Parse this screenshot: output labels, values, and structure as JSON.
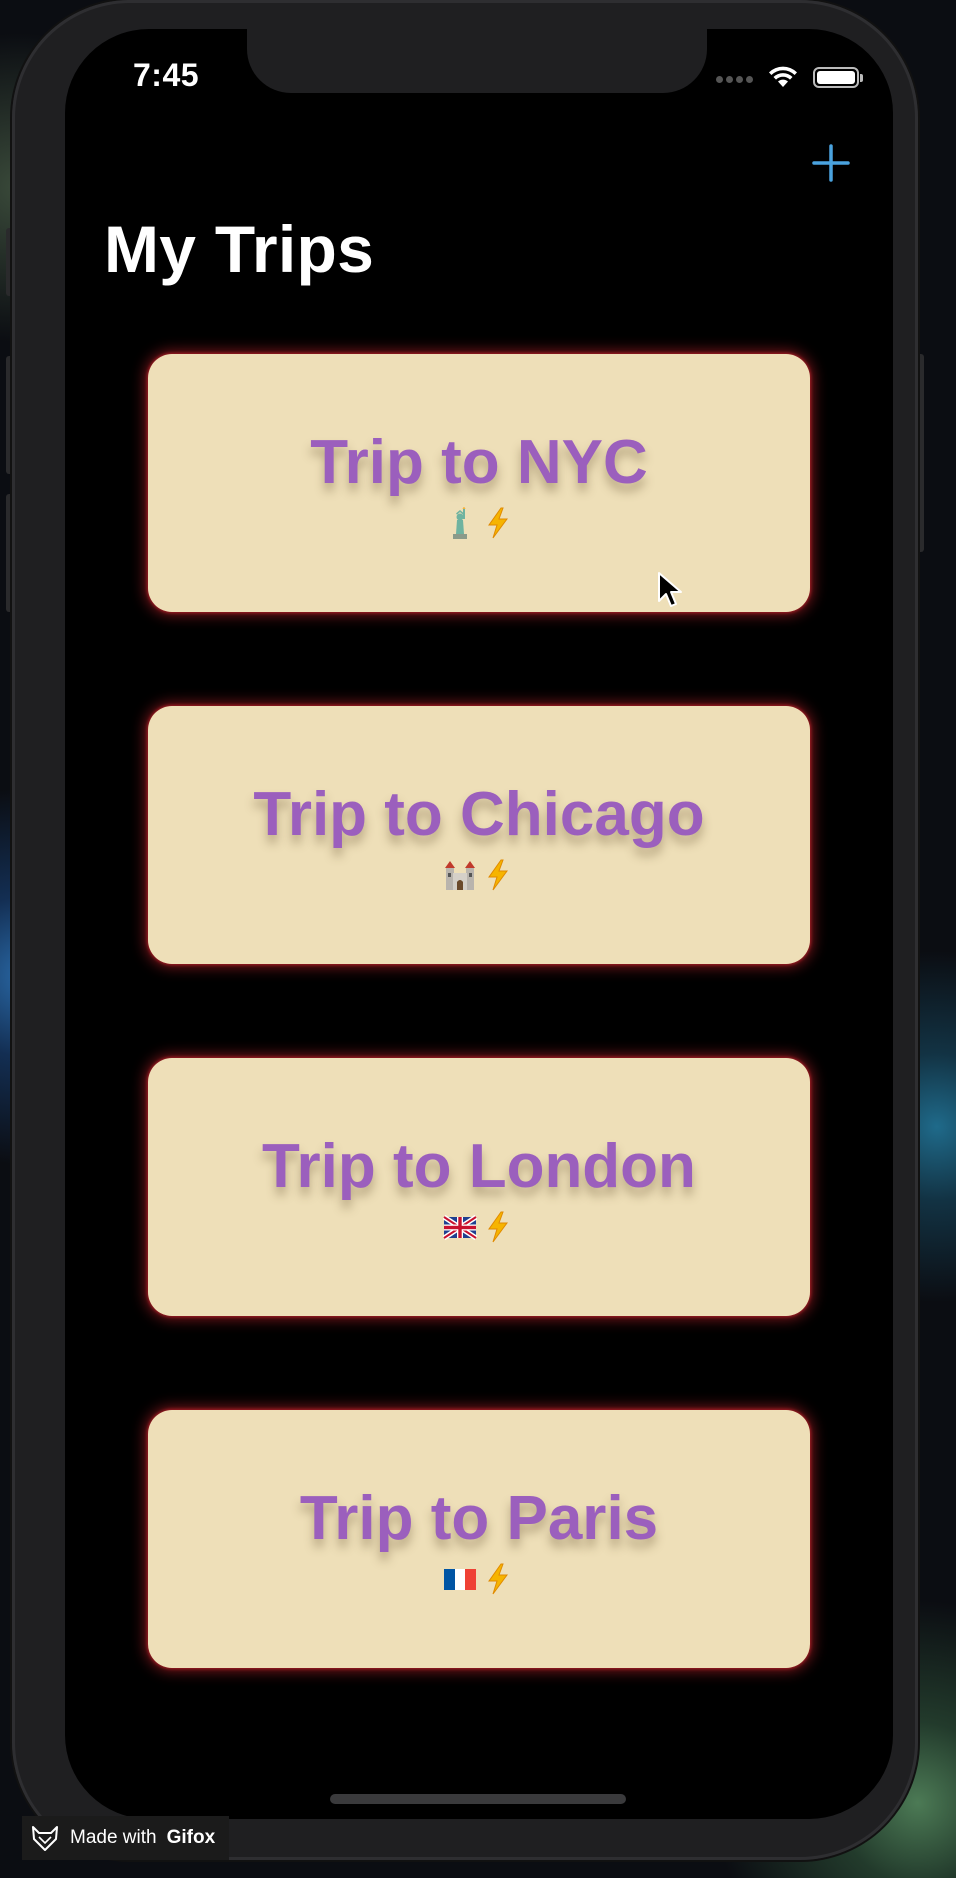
{
  "status_bar": {
    "time": "7:45"
  },
  "header": {
    "title": "My Trips",
    "add_icon": "plus-icon",
    "accent_color": "#4aa3df"
  },
  "trips": [
    {
      "title": "Trip to NYC",
      "emoji": [
        "statue-of-liberty",
        "high-voltage"
      ]
    },
    {
      "title": "Trip to Chicago",
      "emoji": [
        "castle",
        "high-voltage"
      ]
    },
    {
      "title": "Trip to London",
      "emoji": [
        "flag-uk",
        "high-voltage"
      ]
    },
    {
      "title": "Trip to Paris",
      "emoji": [
        "flag-france",
        "high-voltage"
      ]
    }
  ],
  "colors": {
    "card_background": "#eedfb8",
    "card_title": "#9b5fbd",
    "card_glow": "#dc2832"
  },
  "watermark": {
    "prefix": "Made with",
    "brand": "Gifox"
  }
}
